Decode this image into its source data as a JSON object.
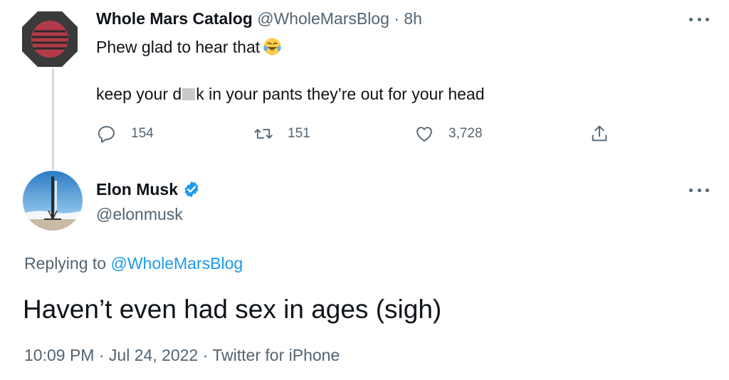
{
  "parent_tweet": {
    "display_name": "Whole Mars Catalog",
    "handle": "@WholeMarsBlog",
    "separator": "·",
    "age": "8h",
    "line1": "Phew glad to hear that",
    "line1_emoji": "face-with-tears-of-joy-emoji",
    "line2_before": "keep your d",
    "line2_after": "k in your pants they’re out for your head",
    "reply_count": "154",
    "retweet_count": "151",
    "like_count": "3,728",
    "avatar_icon": "whole-mars-logo-icon"
  },
  "main_tweet": {
    "display_name": "Elon Musk",
    "handle": "@elonmusk",
    "verified": true,
    "replying_prefix": "Replying to",
    "replying_to": "@WholeMarsBlog",
    "text": "Haven’t even had sex in ages (sigh)",
    "time": "10:09 PM",
    "sep1": "·",
    "date": "Jul 24, 2022",
    "sep2": "·",
    "source": "Twitter for iPhone",
    "avatar_icon": "rocket-launch-photo-icon"
  },
  "colors": {
    "text_primary": "#0f1419",
    "text_secondary": "#536471",
    "link": "#1d9bf0",
    "verified": "#1d9bf0",
    "thread_line": "#cfd9de"
  }
}
